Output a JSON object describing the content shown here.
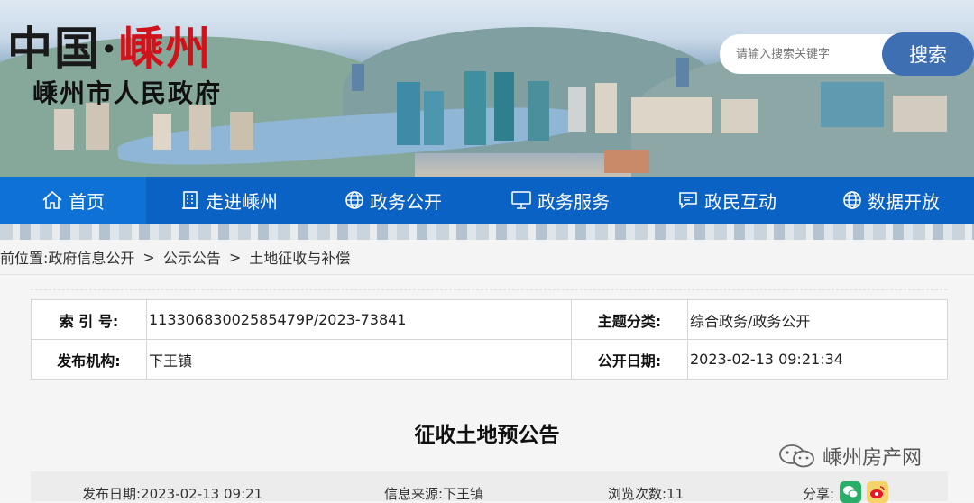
{
  "header": {
    "logo_main": "中国",
    "logo_dot": "·",
    "logo_city": "嵊州",
    "logo_subtitle": "嵊州市人民政府"
  },
  "search": {
    "placeholder": "请输入搜索关键字",
    "button_label": "搜索"
  },
  "nav": {
    "items": [
      {
        "label": "首页",
        "icon": "home-icon",
        "active": true
      },
      {
        "label": "走进嵊州",
        "icon": "building-icon"
      },
      {
        "label": "政务公开",
        "icon": "globe-icon"
      },
      {
        "label": "政务服务",
        "icon": "monitor-icon"
      },
      {
        "label": "政民互动",
        "icon": "chat-icon"
      },
      {
        "label": "数据开放",
        "icon": "globe-icon"
      }
    ]
  },
  "breadcrumb": {
    "prefix": "当前位置:",
    "items": [
      "政府信息公开",
      "公示公告",
      "土地征收与补偿"
    ],
    "separator": ">"
  },
  "meta": {
    "index_label": "索 引 号:",
    "index_value": "11330683002585479P/2023-73841",
    "topic_label": "主题分类:",
    "topic_value": "综合政务/政务公开",
    "publisher_label": "发布机构:",
    "publisher_value": "下王镇",
    "open_date_label": "公开日期:",
    "open_date_value": "2023-02-13 09:21:34"
  },
  "document": {
    "title": "征收土地预公告"
  },
  "info_bar": {
    "publish_date": "发布日期:2023-02-13 09:21",
    "source": "信息来源:下王镇",
    "views": "浏览次数:11",
    "share_label": "分享:"
  },
  "watermark": {
    "text": "嵊州房产网"
  },
  "colors": {
    "nav_bg": "#0a62c4",
    "search_button": "#3e6fb3",
    "logo_red": "#d0121b",
    "wechat_green": "#2aae67",
    "weibo_red": "#e6162d"
  }
}
